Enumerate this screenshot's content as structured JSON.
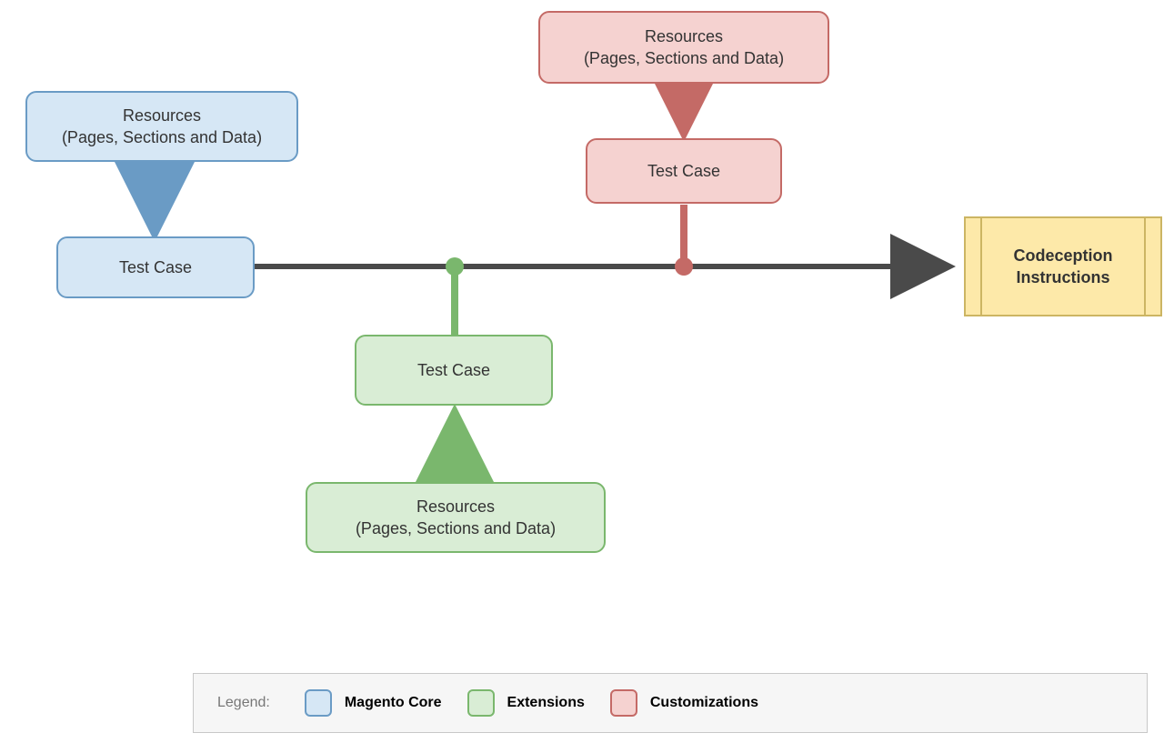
{
  "nodes": {
    "blue_resources": {
      "line1": "Resources",
      "line2": "(Pages, Sections and Data)"
    },
    "blue_test": "Test Case",
    "green_test": "Test Case",
    "green_resources": {
      "line1": "Resources",
      "line2": "(Pages, Sections and Data)"
    },
    "red_resources": {
      "line1": "Resources",
      "line2": "(Pages, Sections and Data)"
    },
    "red_test": "Test Case",
    "output": {
      "line1": "Codeception",
      "line2": "Instructions"
    }
  },
  "legend": {
    "title": "Legend:",
    "items": [
      {
        "color": "blue",
        "label": "Magento Core"
      },
      {
        "color": "green",
        "label": "Extensions"
      },
      {
        "color": "red",
        "label": "Customizations"
      }
    ]
  },
  "colors": {
    "blue_stroke": "#6a9bc5",
    "green_stroke": "#7ab76d",
    "red_stroke": "#c46a66",
    "dark_stroke": "#4a4a4a"
  }
}
